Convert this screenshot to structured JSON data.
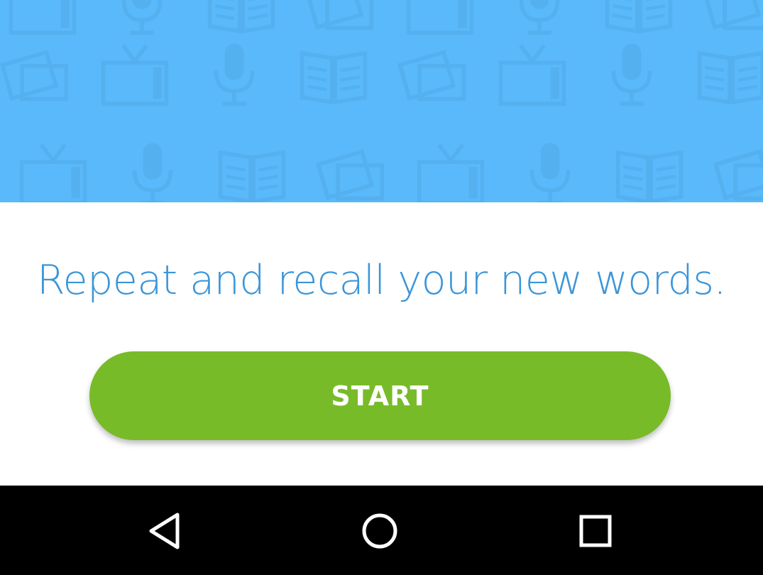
{
  "colors": {
    "hero_bg": "#5ab9fb",
    "hero_pattern": "#54b0ef",
    "tagline": "#3b95d8",
    "start_button": "#78bb28",
    "nav_bar": "#000000",
    "nav_icon": "#ffffff"
  },
  "hero": {
    "pattern_icons": [
      "tv-icon",
      "microphone-icon",
      "book-icon",
      "cards-icon"
    ]
  },
  "main": {
    "tagline": "Repeat and recall your new words.",
    "start_label": "START"
  },
  "navbar": {
    "icons": [
      "back-icon",
      "home-icon",
      "recents-icon"
    ]
  }
}
